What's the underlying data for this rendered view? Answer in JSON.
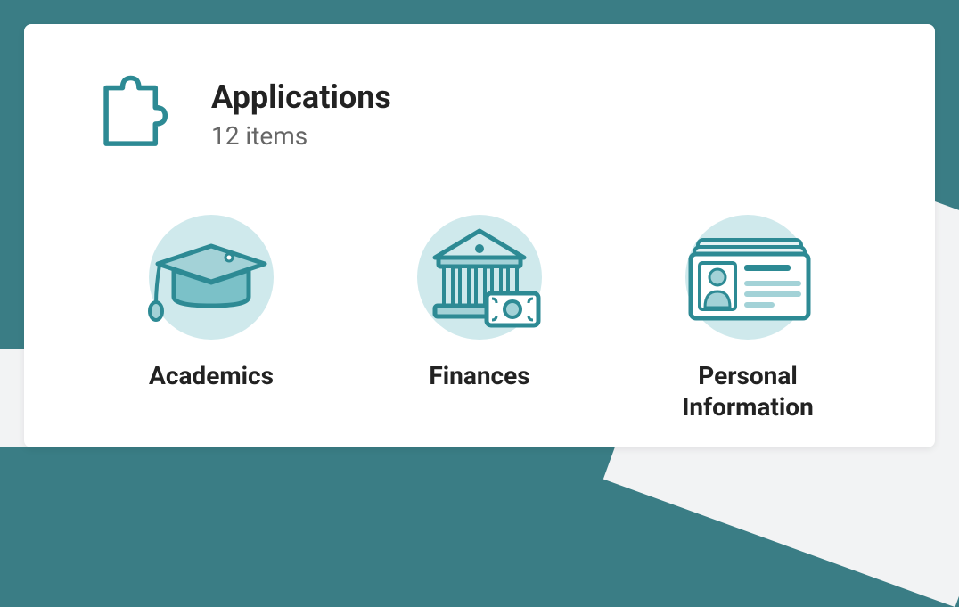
{
  "header": {
    "title": "Applications",
    "subtitle": "12 items"
  },
  "tiles": [
    {
      "label": "Academics"
    },
    {
      "label": "Finances"
    },
    {
      "label": "Personal Information"
    }
  ]
}
